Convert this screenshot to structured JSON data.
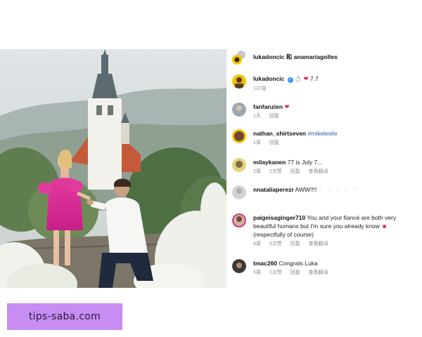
{
  "header": {
    "text": "lukadoncic 和 anamariagoltes"
  },
  "caption": {
    "username": "lukadoncic",
    "number": "7.7",
    "time": "137周"
  },
  "comments": [
    {
      "username": "fanfanzien",
      "text": "",
      "time": "1天",
      "reply": "回复"
    },
    {
      "username": "nathan_shirtseven",
      "text": "#mikeleslie",
      "time": "1周",
      "reply": "回复"
    },
    {
      "username": "milaykanen",
      "text": "77 is July 7...",
      "time": "2周",
      "likes": "2次赞",
      "reply": "回复",
      "translate": "查看翻译"
    },
    {
      "username": "nnataliaperezr",
      "text": "AWW!!!!",
      "emoji": "♡ ♡ ♡ ♡ ♡",
      "time": "",
      "reply": ""
    },
    {
      "username": "paigeisaginger710",
      "text": "You and your fiancé are both very beautiful humans but I'm sure you already know",
      "text_end": "(respectfully of course)",
      "time": "4周",
      "likes": "3次赞",
      "reply": "回复",
      "translate": "查看翻译"
    },
    {
      "username": "tmac260",
      "text": "Congrats Luka",
      "time": "5周",
      "likes": "2次赞",
      "reply": "回复",
      "translate": "查看翻译"
    }
  ],
  "watermark": {
    "text": "tips-saba.com"
  },
  "colors": {
    "verified": "#3897f0",
    "heart": "#e0245e",
    "hashtag": "#2b5fa6",
    "watermark_bg": "#c78df2"
  }
}
